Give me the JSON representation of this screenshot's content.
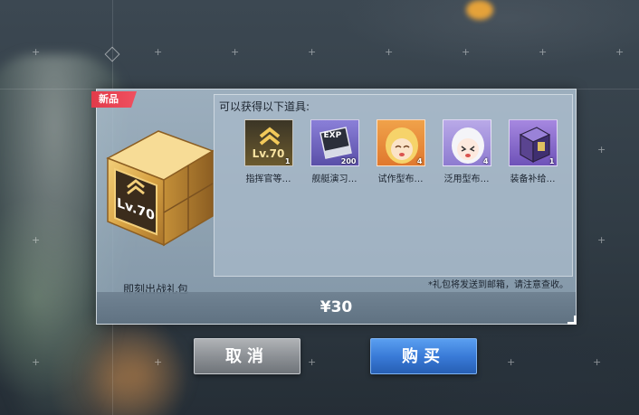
{
  "dialog": {
    "new_tag": "新品",
    "pack_name": "即刻出战礼包",
    "crate_level_text": "Lv.70",
    "items_title": "可以获得以下道具:",
    "items": [
      {
        "label": "指挥官等…",
        "count": "1",
        "icon": "level-up-icon"
      },
      {
        "label": "舰艇演习…",
        "count": "200",
        "icon": "exp-book-icon"
      },
      {
        "label": "试作型布…",
        "count": "4",
        "icon": "prototype-bulin-icon"
      },
      {
        "label": "泛用型布…",
        "count": "4",
        "icon": "universal-bulin-icon"
      },
      {
        "label": "装备补给…",
        "count": "1",
        "icon": "equipment-box-icon"
      }
    ],
    "level_icon_text": "Lv.70",
    "exp_icon_text": "EXP",
    "note": "*礼包将发送到邮箱，请注意查收。",
    "price": "¥30"
  },
  "buttons": {
    "cancel": "取消",
    "buy": "购买"
  },
  "colors": {
    "buy_button": "#3a7bd8",
    "cancel_button": "#8d9196",
    "new_tag": "#e13b4a",
    "crate_gold": "#d9a445"
  }
}
